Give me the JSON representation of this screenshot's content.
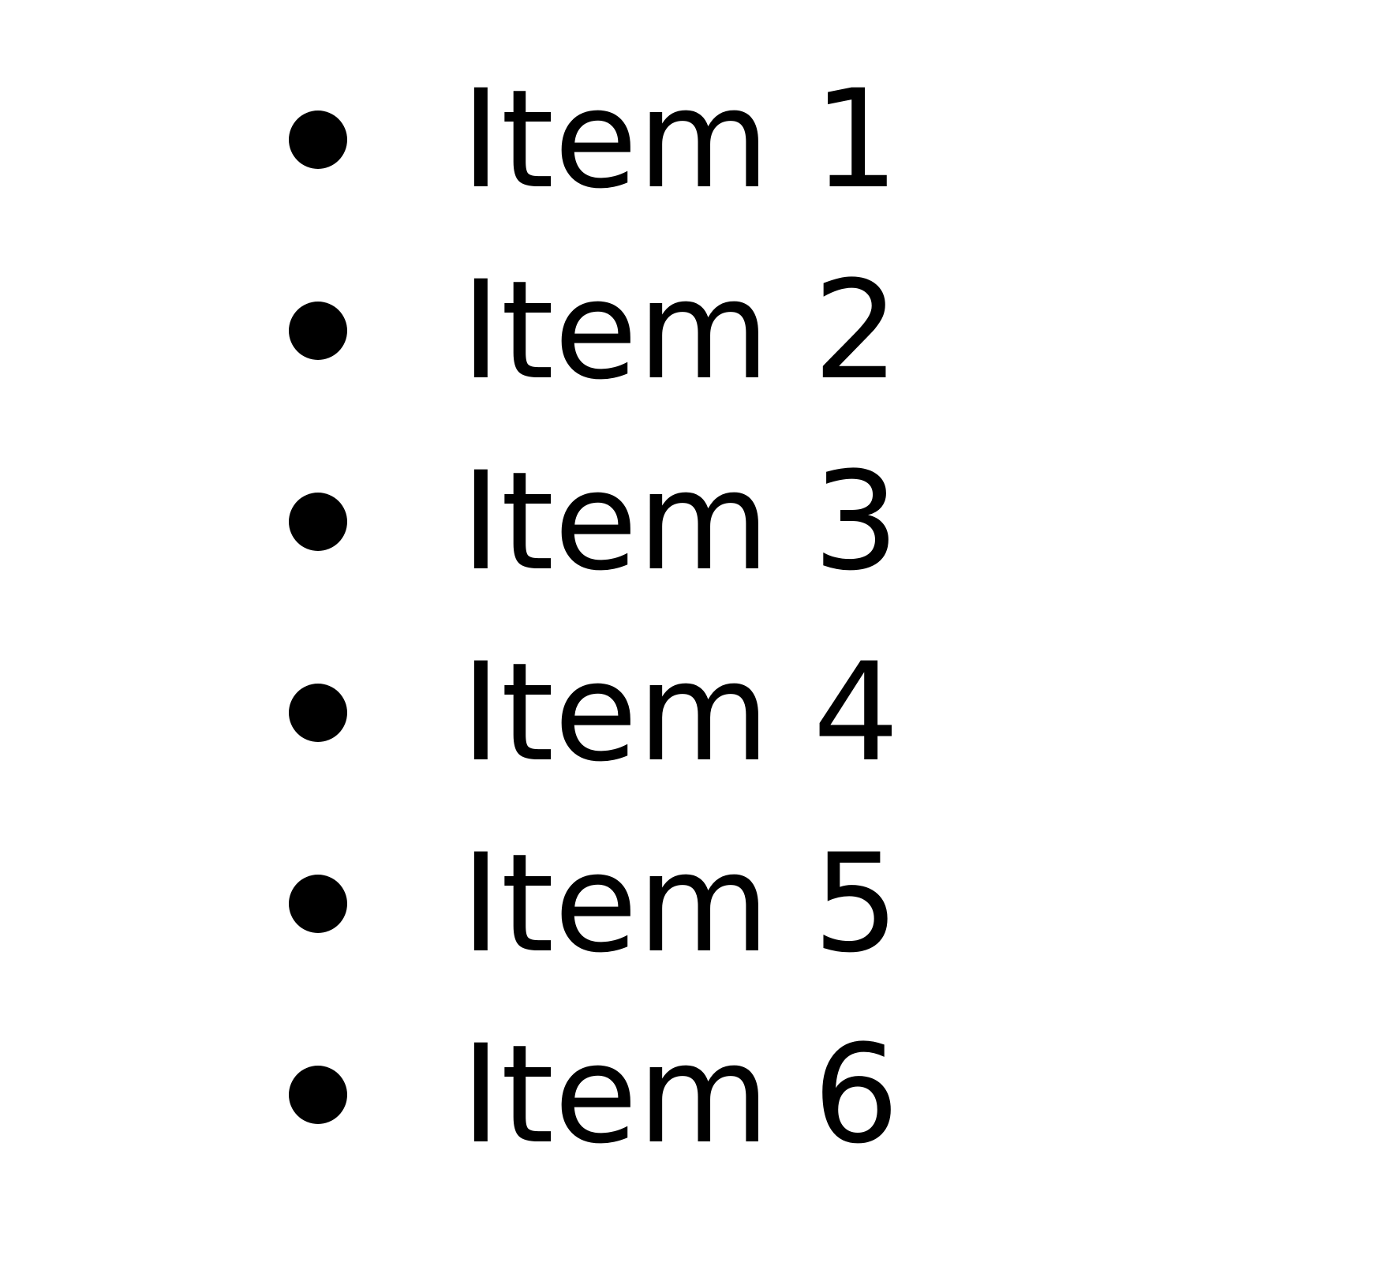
{
  "list": {
    "items": [
      {
        "label": "Item 1"
      },
      {
        "label": "Item 2"
      },
      {
        "label": "Item 3"
      },
      {
        "label": "Item 4"
      },
      {
        "label": "Item 5"
      },
      {
        "label": "Item 6"
      }
    ]
  }
}
